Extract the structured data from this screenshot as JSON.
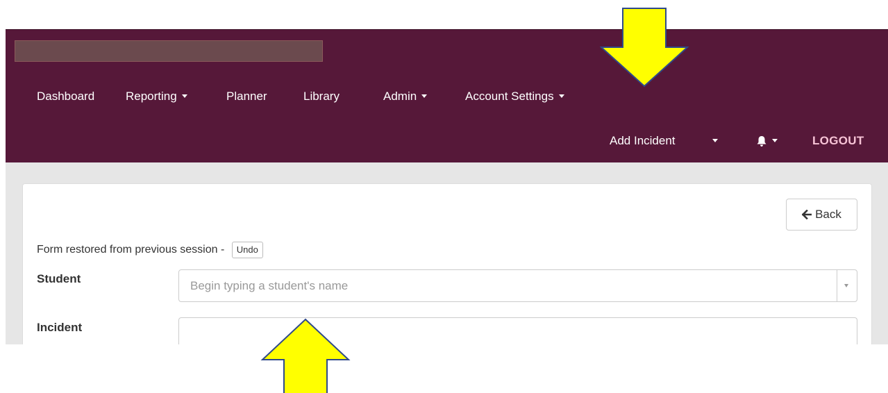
{
  "nav": {
    "items": [
      {
        "label": "Dashboard",
        "has_caret": false
      },
      {
        "label": "Reporting",
        "has_caret": true
      },
      {
        "label": "Planner",
        "has_caret": false
      },
      {
        "label": "Library",
        "has_caret": false
      },
      {
        "label": "Admin",
        "has_caret": true
      },
      {
        "label": "Account Settings",
        "has_caret": true
      }
    ],
    "add_incident_label": "Add Incident",
    "logout_label": "LOGOUT",
    "bell_icon": "bell-icon",
    "colors": {
      "navbar_bg": "#561839",
      "logout_text": "#f7c3d6",
      "content_bg": "#e6e6e6"
    }
  },
  "form": {
    "back_label": "Back",
    "restored_text": "Form restored from previous session -",
    "undo_label": "Undo",
    "student_label": "Student",
    "student_placeholder": "Begin typing a student's name",
    "incident_label": "Incident"
  },
  "annotations": {
    "arrow_color": "#ffff00",
    "arrow_outline": "#2f4a8a"
  }
}
